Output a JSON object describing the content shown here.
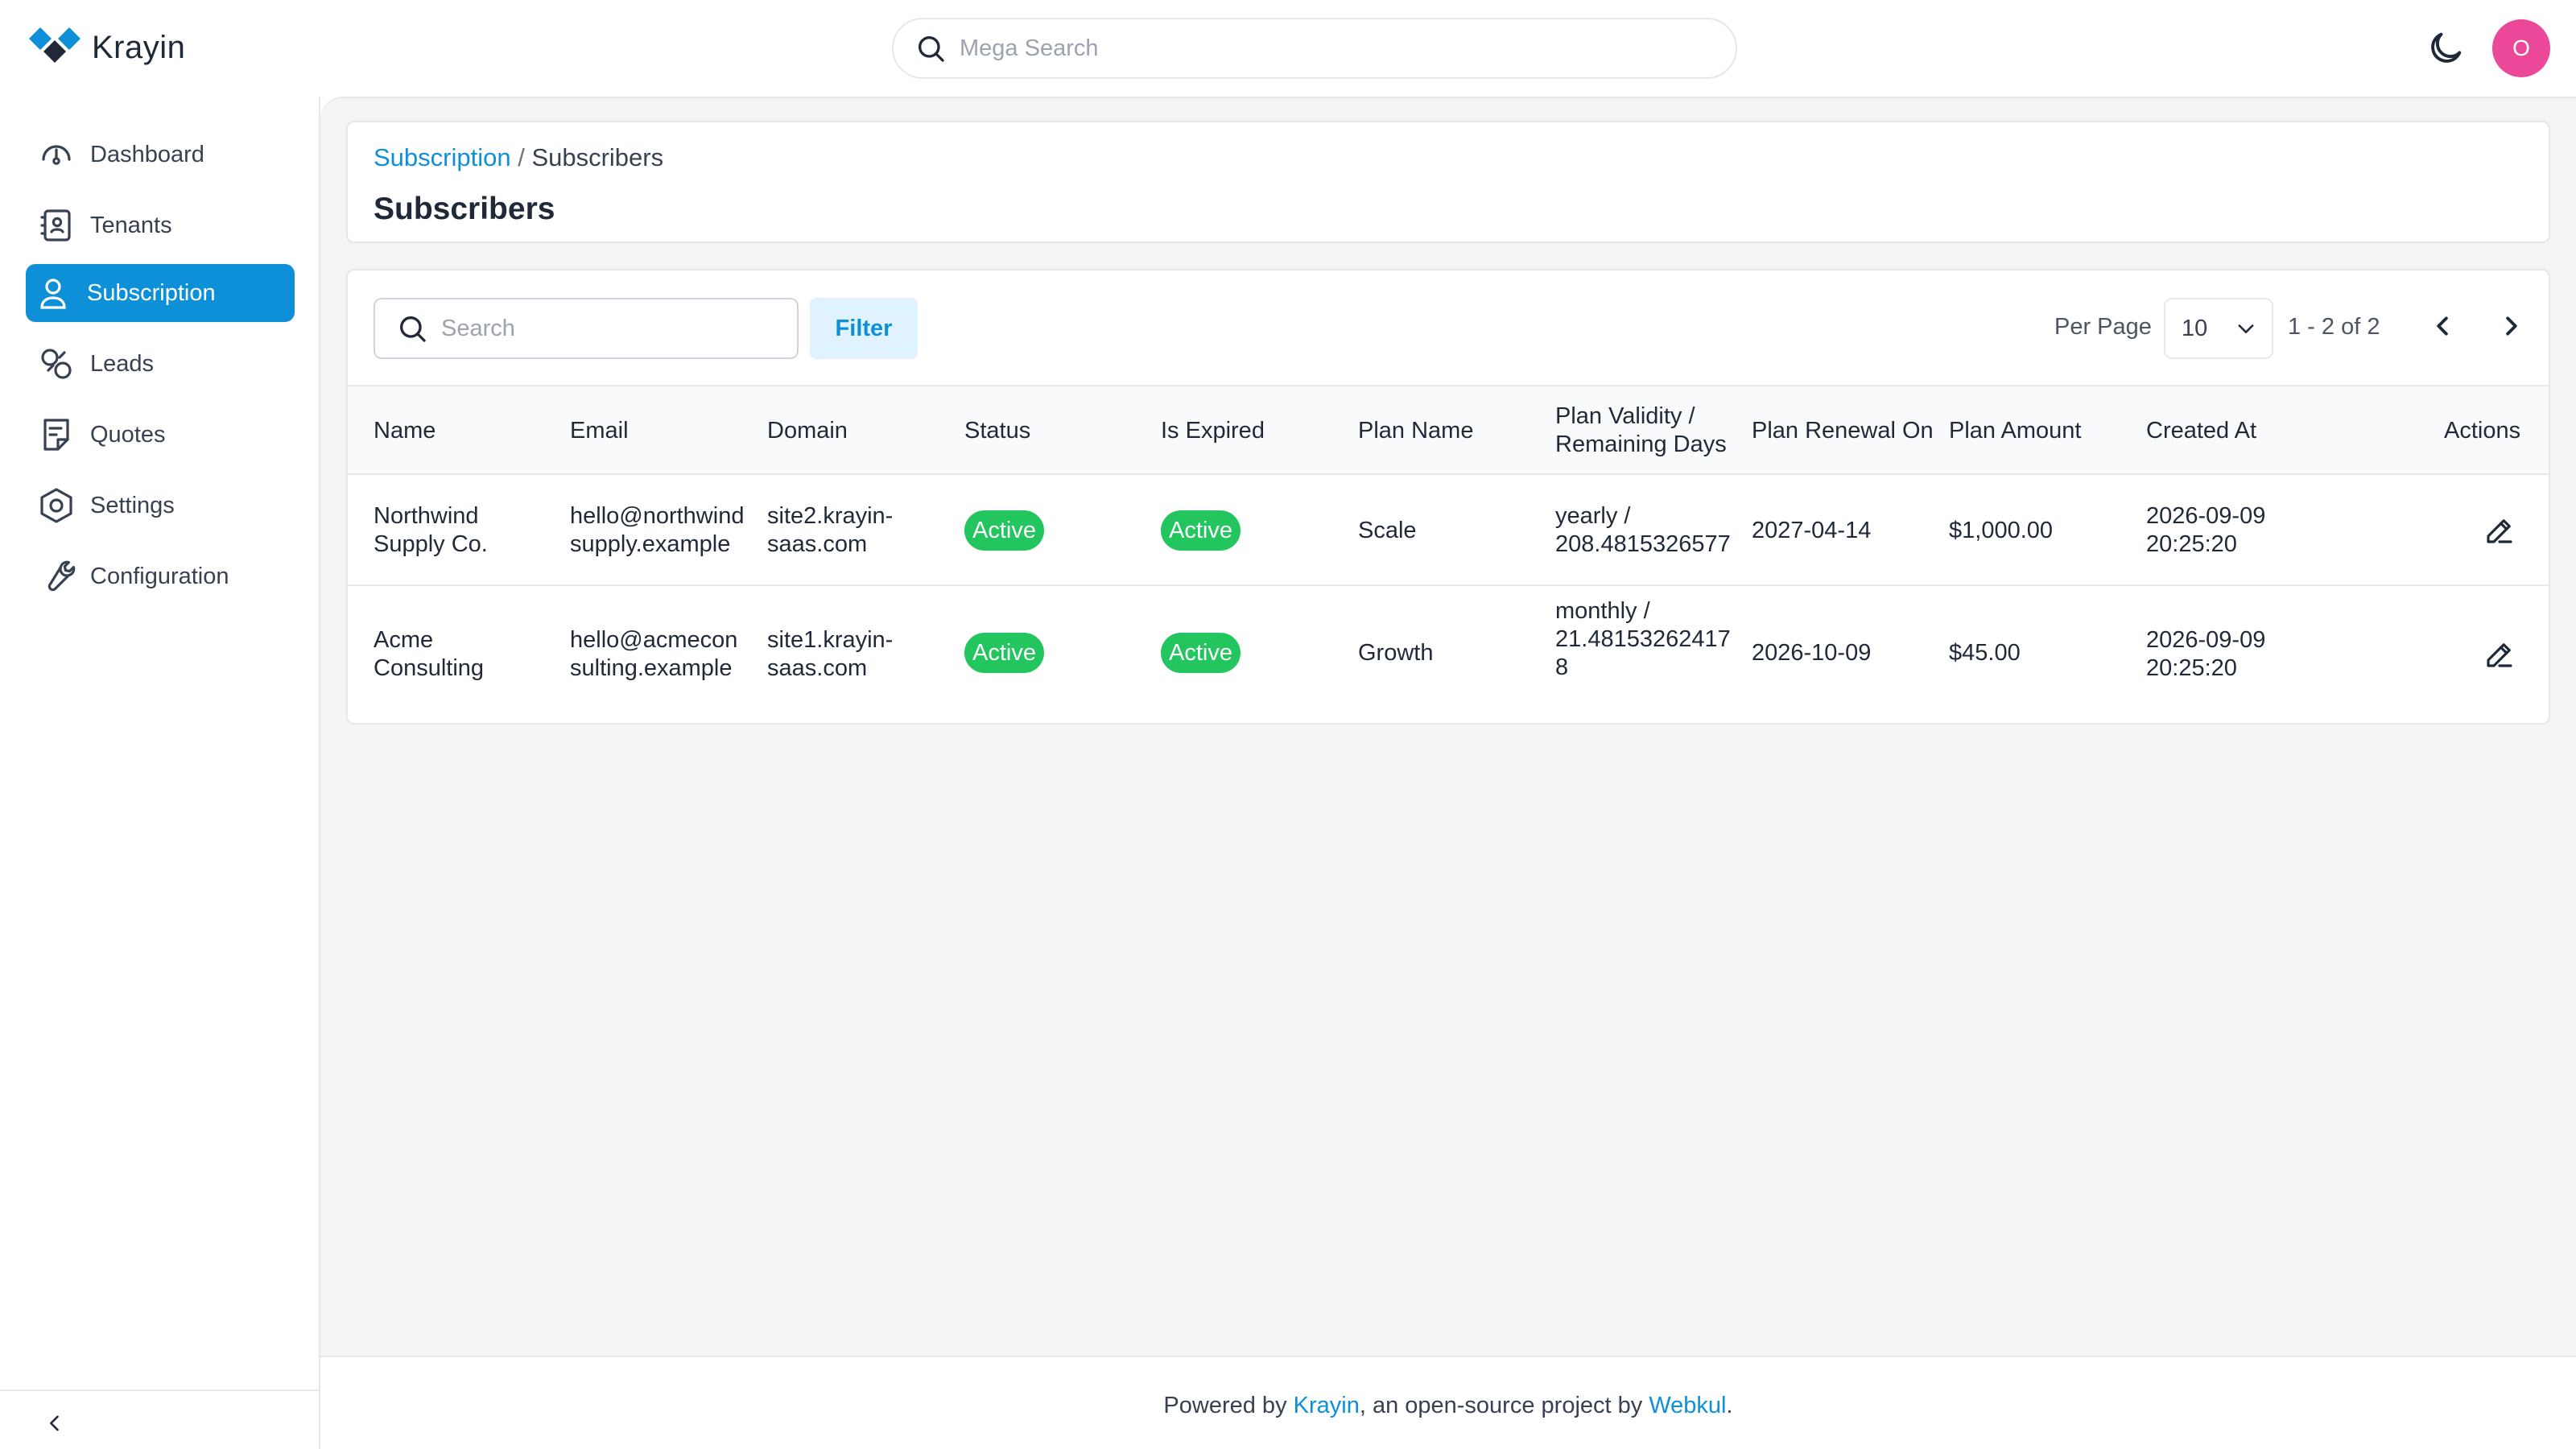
{
  "app": {
    "name": "Krayin"
  },
  "header": {
    "search_placeholder": "Mega Search",
    "avatar_initial": "O"
  },
  "sidebar": {
    "items": [
      {
        "label": "Dashboard",
        "icon": "dashboard-icon"
      },
      {
        "label": "Tenants",
        "icon": "tenants-icon"
      },
      {
        "label": "Subscription",
        "icon": "user-icon",
        "active": true
      },
      {
        "label": "Leads",
        "icon": "leads-icon"
      },
      {
        "label": "Quotes",
        "icon": "quotes-icon"
      },
      {
        "label": "Settings",
        "icon": "settings-icon"
      },
      {
        "label": "Configuration",
        "icon": "wrench-icon"
      }
    ]
  },
  "breadcrumb": {
    "parent": "Subscription",
    "separator": " / ",
    "current": "Subscribers"
  },
  "page": {
    "title": "Subscribers"
  },
  "toolbar": {
    "search_placeholder": "Search",
    "filter_label": "Filter",
    "per_page_label": "Per Page",
    "per_page_value": "10",
    "pagination_info": "1 - 2 of 2"
  },
  "table": {
    "columns": {
      "name": "Name",
      "email": "Email",
      "domain": "Domain",
      "status": "Status",
      "is_expired": "Is Expired",
      "plan_name": "Plan Name",
      "plan_validity_1": "Plan Validity /",
      "plan_validity_2": "Remaining Days",
      "plan_renewal": "Plan Renewal On",
      "plan_amount": "Plan Amount",
      "created_at": "Created At",
      "actions": "Actions"
    },
    "rows": [
      {
        "name_1": "Northwind",
        "name_2": "Supply Co.",
        "email_1": "hello@northwind",
        "email_2": "supply.example",
        "domain_1": "site2.krayin-",
        "domain_2": "saas.com",
        "status": "Active",
        "is_expired": "Active",
        "plan_name": "Scale",
        "validity_1": "yearly /",
        "validity_2": "208.4815326577",
        "renewal": "2027-04-14",
        "amount": "$1,000.00",
        "created_1": "2026-09-09",
        "created_2": "20:25:20"
      },
      {
        "name_1": "Acme",
        "name_2": "Consulting",
        "email_1": "hello@acmecon",
        "email_2": "sulting.example",
        "domain_1": "site1.krayin-",
        "domain_2": "saas.com",
        "status": "Active",
        "is_expired": "Active",
        "plan_name": "Growth",
        "validity_1": "monthly /",
        "validity_2": "21.48153262417",
        "validity_3": "8",
        "renewal": "2026-10-09",
        "amount": "$45.00",
        "created_1": "2026-09-09",
        "created_2": "20:25:20"
      }
    ]
  },
  "footer": {
    "prefix": "Powered by ",
    "link1": "Krayin",
    "middle": ", an open-source project by ",
    "link2": "Webkul",
    "suffix": "."
  },
  "colors": {
    "accent": "#0e90d9",
    "badge_green": "#22c55e",
    "avatar_pink": "#ec4899"
  }
}
